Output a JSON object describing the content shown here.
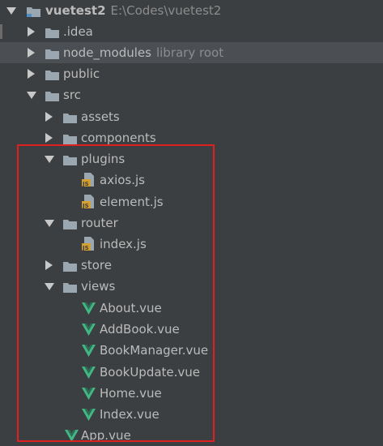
{
  "project": {
    "name": "vuetest2",
    "path": "E:\\Codes\\vuetest2"
  },
  "items": [
    {
      "label": "vuetest2",
      "extra": "E:\\Codes\\vuetest2",
      "icon": "project-folder-icon",
      "state": "expanded",
      "level": 0
    },
    {
      "label": ".idea",
      "icon": "folder-icon",
      "state": "collapsed",
      "level": 1
    },
    {
      "label": "node_modules",
      "extra": "library root",
      "icon": "folder-icon",
      "state": "collapsed",
      "level": 1
    },
    {
      "label": "public",
      "icon": "folder-icon",
      "state": "collapsed",
      "level": 1
    },
    {
      "label": "src",
      "icon": "folder-icon",
      "state": "expanded",
      "level": 1
    },
    {
      "label": "assets",
      "icon": "folder-icon",
      "state": "collapsed",
      "level": 2
    },
    {
      "label": "components",
      "icon": "folder-icon",
      "state": "collapsed",
      "level": 2
    },
    {
      "label": "plugins",
      "icon": "folder-icon",
      "state": "expanded",
      "level": 2
    },
    {
      "label": "axios.js",
      "icon": "js-file-icon",
      "state": "leaf",
      "level": 3
    },
    {
      "label": "element.js",
      "icon": "js-file-icon",
      "state": "leaf",
      "level": 3
    },
    {
      "label": "router",
      "icon": "folder-icon",
      "state": "expanded",
      "level": 2
    },
    {
      "label": "index.js",
      "icon": "js-file-icon",
      "state": "leaf",
      "level": 3
    },
    {
      "label": "store",
      "icon": "folder-icon",
      "state": "collapsed",
      "level": 2
    },
    {
      "label": "views",
      "icon": "folder-icon",
      "state": "expanded",
      "level": 2
    },
    {
      "label": "About.vue",
      "icon": "vue-file-icon",
      "state": "leaf",
      "level": 3
    },
    {
      "label": "AddBook.vue",
      "icon": "vue-file-icon",
      "state": "leaf",
      "level": 3
    },
    {
      "label": "BookManager.vue",
      "icon": "vue-file-icon",
      "state": "leaf",
      "level": 3
    },
    {
      "label": "BookUpdate.vue",
      "icon": "vue-file-icon",
      "state": "leaf",
      "level": 3
    },
    {
      "label": "Home.vue",
      "icon": "vue-file-icon",
      "state": "leaf",
      "level": 3
    },
    {
      "label": "Index.vue",
      "icon": "vue-file-icon",
      "state": "leaf",
      "level": 3
    },
    {
      "label": "App.vue",
      "icon": "vue-file-icon",
      "state": "leaf",
      "level": 2
    }
  ],
  "colors": {
    "background": "#3c3f41",
    "text": "#bbbbbb",
    "muted_text": "#8c8c8c",
    "folder": "#9aa7b0",
    "js_badge": "#d4a030",
    "vue_green": "#41b883",
    "highlight_row": "#4b4f54",
    "annotation_red": "#e02020"
  },
  "annotation": {
    "type": "red-rectangle",
    "covers": [
      "plugins",
      "axios.js",
      "element.js",
      "router",
      "index.js",
      "store",
      "views",
      "About.vue",
      "AddBook.vue",
      "BookManager.vue",
      "BookUpdate.vue",
      "Home.vue",
      "Index.vue",
      "App.vue"
    ]
  }
}
